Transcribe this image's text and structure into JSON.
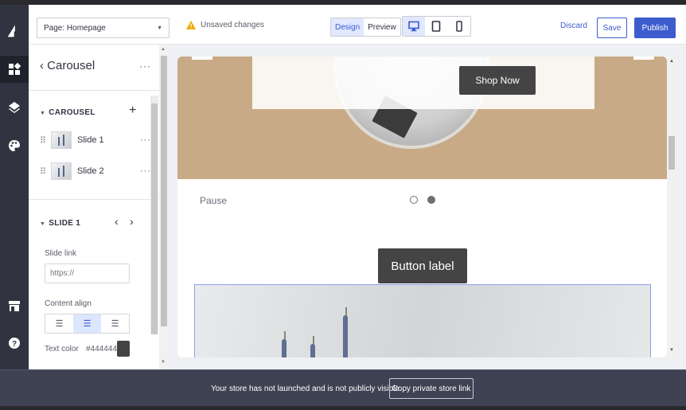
{
  "colors": {
    "accent": "#3d5cce",
    "rail_bg": "#313440",
    "footer_bg": "#3f4253",
    "hero_bg": "#c9aa86",
    "warning": "#f0a800",
    "text_color_swatch": "#444444"
  },
  "topbar": {
    "page_select": "Page: Homepage",
    "unsaved": "Unsaved changes",
    "mode_design": "Design",
    "mode_preview": "Preview",
    "discard": "Discard",
    "save": "Save",
    "publish": "Publish"
  },
  "rail": {
    "icons": [
      "logo-icon",
      "sections-icon",
      "layers-icon",
      "palette-icon",
      "store-icon",
      "help-icon"
    ]
  },
  "panel": {
    "back_label": "Carousel",
    "carousel_section": "CAROUSEL",
    "slides": [
      {
        "label": "Slide 1"
      },
      {
        "label": "Slide 2"
      }
    ],
    "slide_section": "SLIDE 1",
    "slide_link_label": "Slide link",
    "slide_link_placeholder": "https://",
    "content_align_label": "Content align",
    "text_color_label": "Text color",
    "text_color_value": "#444444"
  },
  "canvas": {
    "shop_now": "Shop Now",
    "pause": "Pause",
    "button_label": "Button label",
    "active_dot": 2,
    "dot_count": 2
  },
  "footer": {
    "message": "Your store has not launched and is not publicly visible.",
    "copy_link": "Copy private store link"
  }
}
